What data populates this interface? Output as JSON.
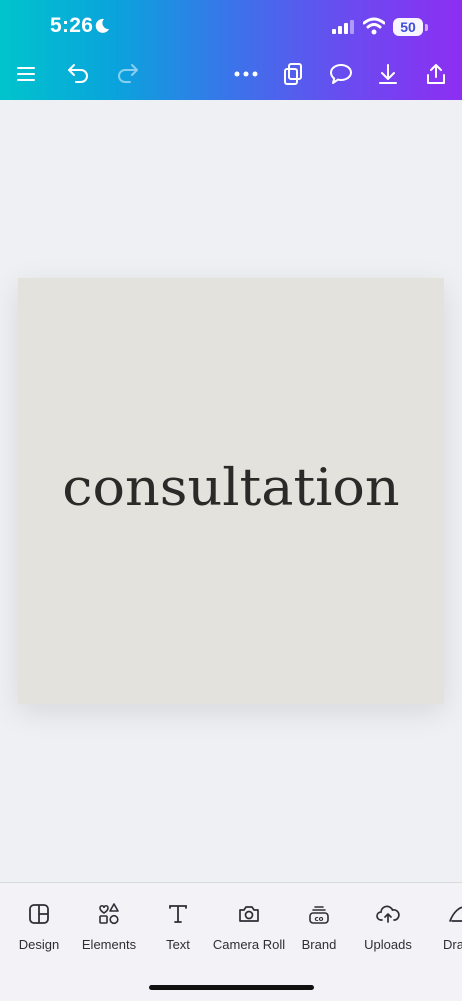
{
  "status_bar": {
    "time": "5:26",
    "battery": "50",
    "icons": [
      "moon-icon",
      "signal-icon",
      "wifi-icon",
      "battery-icon"
    ]
  },
  "toolbar": {
    "icons": [
      "menu-icon",
      "undo-icon",
      "redo-icon",
      "more-icon",
      "pages-icon",
      "comment-icon",
      "download-icon",
      "share-icon"
    ]
  },
  "canvas": {
    "text": "consultation",
    "background_color": "#e4e2dd",
    "text_color": "#2a2a28"
  },
  "bottom_tabs": [
    {
      "label": "Design",
      "icon": "design-icon"
    },
    {
      "label": "Elements",
      "icon": "elements-icon"
    },
    {
      "label": "Text",
      "icon": "text-icon"
    },
    {
      "label": "Camera Roll",
      "icon": "camera-icon"
    },
    {
      "label": "Brand",
      "icon": "brand-icon"
    },
    {
      "label": "Uploads",
      "icon": "uploads-icon"
    },
    {
      "label": "Dra",
      "icon": "draw-icon"
    }
  ],
  "colors": {
    "gradient_start": "#00c4cc",
    "gradient_end": "#8d2ef2",
    "page_bg": "#eff0f4"
  }
}
